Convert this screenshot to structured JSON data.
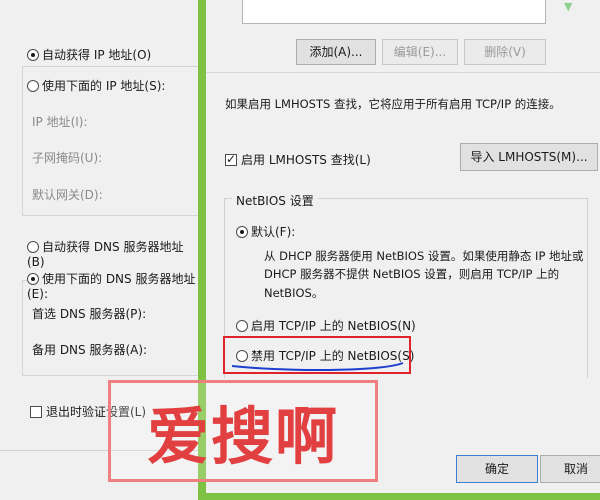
{
  "left": {
    "auto_ip": "自动获得 IP 地址(O)",
    "manual_ip": "使用下面的 IP 地址(S):",
    "ip_address": "IP 地址(I):",
    "subnet_mask": "子网掩码(U):",
    "default_gateway": "默认网关(D):",
    "auto_dns": "自动获得 DNS 服务器地址(B)",
    "manual_dns": "使用下面的 DNS 服务器地址(E):",
    "preferred_dns": "首选 DNS 服务器(P):",
    "alternate_dns": "备用 DNS 服务器(A):",
    "validate_on_exit": "退出时验证设置(L)"
  },
  "right": {
    "add_button": "添加(A)...",
    "edit_button": "编辑(E)...",
    "remove_button": "删除(V)",
    "lmhosts_note": "如果启用 LMHOSTS 查找，它将应用于所有启用 TCP/IP 的连接。",
    "enable_lmhosts": "启用 LMHOSTS 查找(L)",
    "import_lmhosts": "导入 LMHOSTS(M)...",
    "netbios_group": "NetBIOS 设置",
    "default_option": "默认(F):",
    "default_desc_1": "从 DHCP 服务器使用 NetBIOS 设置。如果使用静态 IP 地址或",
    "default_desc_2": "DHCP 服务器不提供 NetBIOS 设置，则启用 TCP/IP 上的",
    "default_desc_3": "NetBIOS。",
    "enable_netbios": "启用 TCP/IP 上的 NetBIOS(N)",
    "disable_netbios": "禁用 TCP/IP 上的 NetBIOS(S)",
    "ok_button": "确定",
    "cancel_button": "取消"
  },
  "watermark": {
    "text": "爱搜啊"
  },
  "colors": {
    "green_border": "#7dc242",
    "highlight_red": "#e0232b",
    "underline_blue": "#1c3fcf",
    "watermark_red": "#e24040"
  }
}
